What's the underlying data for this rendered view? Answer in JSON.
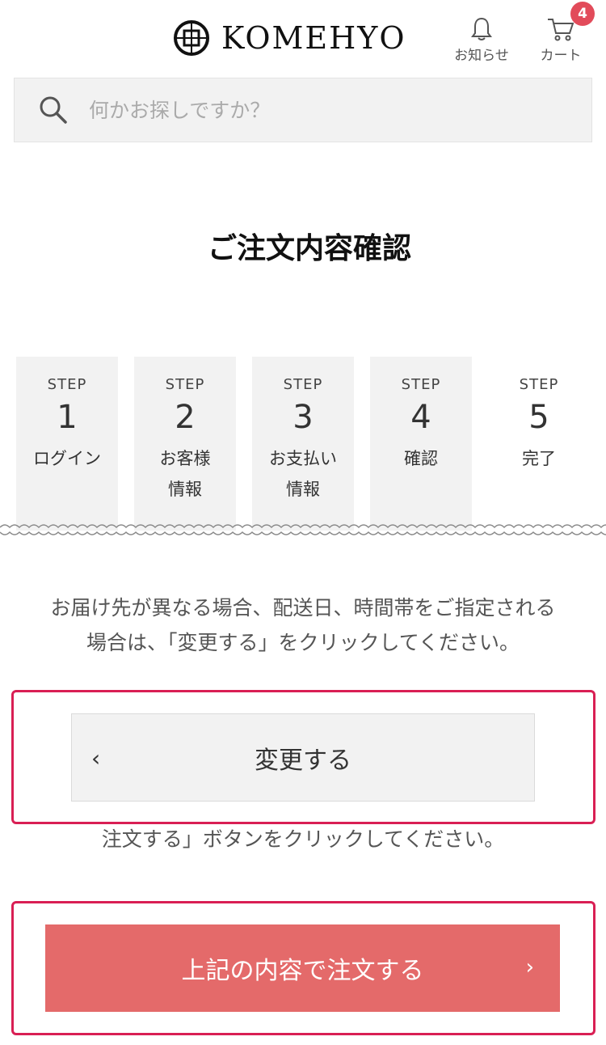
{
  "header": {
    "brand": "KOMEHYO",
    "notification_label": "お知らせ",
    "cart_label": "カート",
    "cart_count": "4",
    "icons": {
      "notification": "bell-icon",
      "cart": "cart-icon",
      "search": "search-icon"
    }
  },
  "search": {
    "placeholder": "何かお探しですか？"
  },
  "page_title": "ご注文内容確認",
  "steps": [
    {
      "label": "STEP",
      "number": "1",
      "name": "ログイン"
    },
    {
      "label": "STEP",
      "number": "2",
      "name": "お客様\n情報"
    },
    {
      "label": "STEP",
      "number": "3",
      "name": "お支払い\n情報"
    },
    {
      "label": "STEP",
      "number": "4",
      "name": "確認"
    },
    {
      "label": "STEP",
      "number": "5",
      "name": "完了"
    }
  ],
  "notice": "お届け先が異なる場合、配送日、時間帯をご指定される場合は、「変更する」をクリックしてください。",
  "change_button": {
    "label": "変更する",
    "icon": "chevron-left-icon"
  },
  "notice_order": "注文する」ボタンをクリックしてください。",
  "order_button": {
    "label": "上記の内容で注文する",
    "icon": "chevron-right-icon"
  },
  "colors": {
    "accent": "#e46a6a",
    "highlight": "#d91f54",
    "badge": "#e24b5a",
    "step_bg": "#f2f2f2"
  }
}
